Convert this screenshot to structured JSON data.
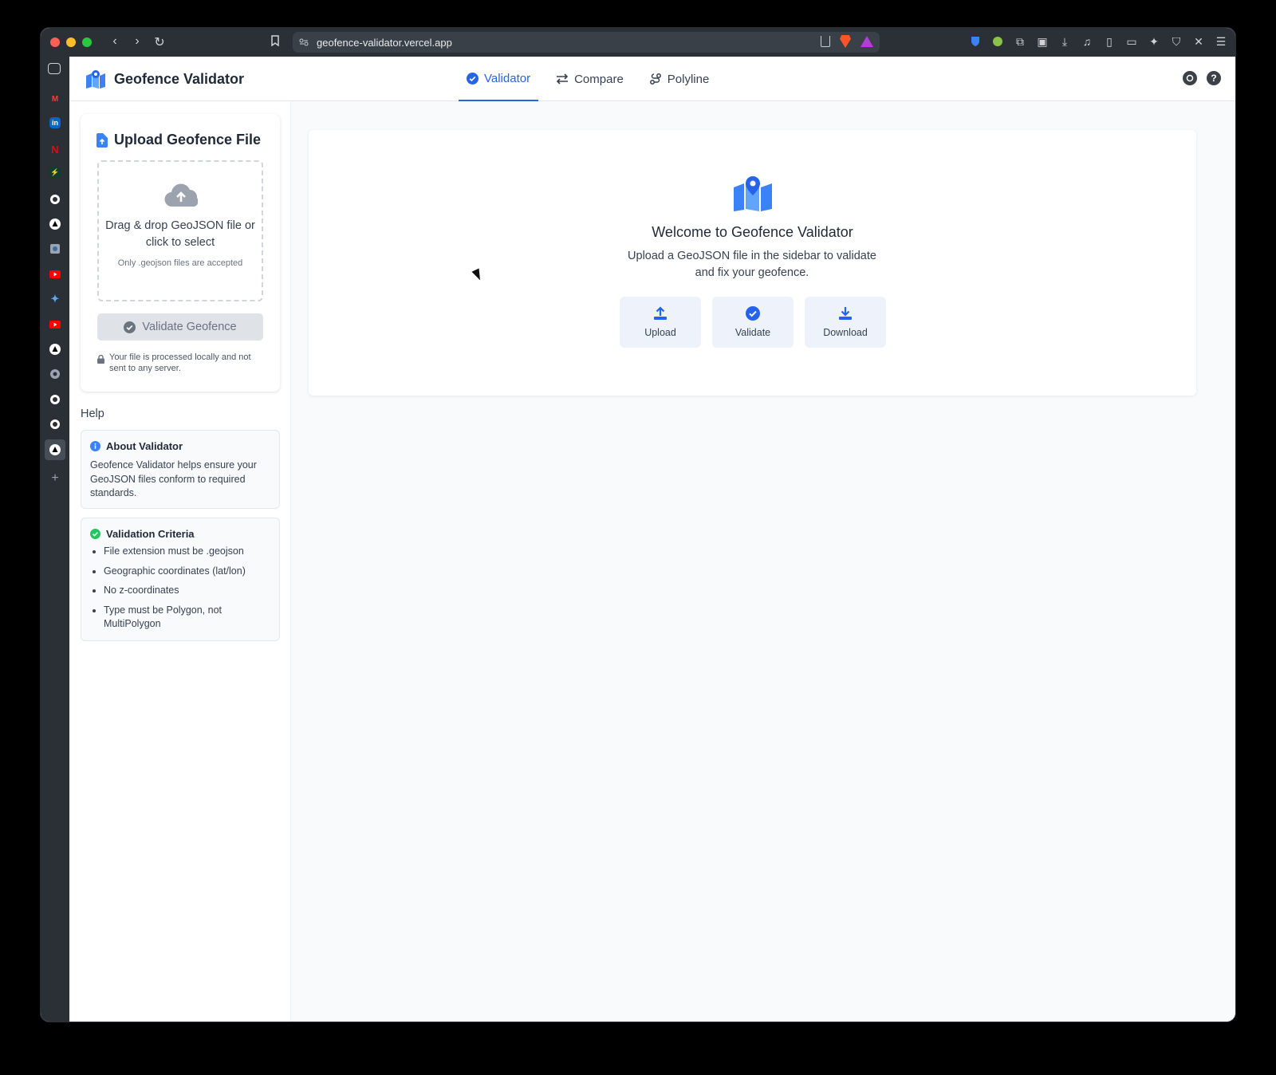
{
  "browser": {
    "url": "geofence-validator.vercel.app"
  },
  "app": {
    "title": "Geofence Validator",
    "tabs": [
      {
        "label": "Validator",
        "active": true
      },
      {
        "label": "Compare",
        "active": false
      },
      {
        "label": "Polyline",
        "active": false
      }
    ]
  },
  "sidebar": {
    "upload_title": "Upload Geofence File",
    "dropzone_main": "Drag & drop GeoJSON file or click to select",
    "dropzone_sub": "Only .geojson files are accepted",
    "validate_label": "Validate Geofence",
    "privacy_note": "Your file is processed locally and not sent to any server.",
    "help_heading": "Help",
    "about": {
      "title": "About Validator",
      "body": "Geofence Validator helps ensure your GeoJSON files conform to required standards."
    },
    "criteria": {
      "title": "Validation Criteria",
      "items": [
        "File extension must be .geojson",
        "Geographic coordinates (lat/lon)",
        "No z-coordinates",
        "Type must be Polygon, not MultiPolygon"
      ]
    }
  },
  "main": {
    "welcome_title": "Welcome to Geofence Validator",
    "welcome_text": "Upload a GeoJSON file in the sidebar to validate and fix your geofence.",
    "actions": [
      {
        "label": "Upload",
        "icon": "upload-icon"
      },
      {
        "label": "Validate",
        "icon": "check-circle-icon"
      },
      {
        "label": "Download",
        "icon": "download-icon"
      }
    ]
  },
  "colors": {
    "accent": "#2563eb",
    "icon_blue": "#3b82f6",
    "success": "#22c55e"
  }
}
